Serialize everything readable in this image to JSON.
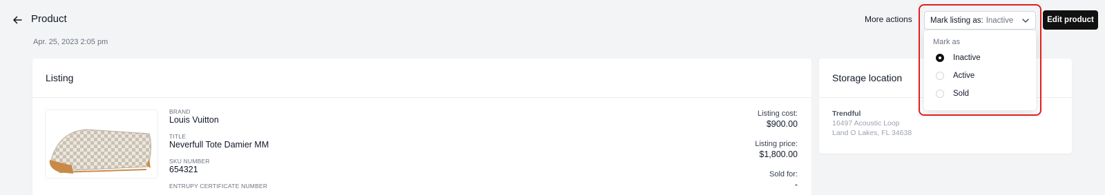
{
  "header": {
    "title": "Product",
    "timestamp": "Apr. 25, 2023 2:05 pm",
    "more_actions_label": "More actions",
    "mark_select": {
      "label": "Mark listing as:",
      "value": "Inactive"
    },
    "edit_label": "Edit product"
  },
  "dropdown": {
    "heading": "Mark as",
    "options": [
      {
        "label": "Inactive",
        "selected": true
      },
      {
        "label": "Active",
        "selected": false
      },
      {
        "label": "Sold",
        "selected": false
      }
    ]
  },
  "listing": {
    "title": "Listing",
    "fields": [
      {
        "label": "BRAND",
        "value": "Louis Vuitton"
      },
      {
        "label": "TITLE",
        "value": "Neverfull Tote Damier MM"
      },
      {
        "label": "SKU NUMBER",
        "value": "654321"
      },
      {
        "label": "ENTRUPY CERTIFICATE NUMBER",
        "value": ""
      }
    ],
    "prices": [
      {
        "label": "Listing cost:",
        "value": "$900.00"
      },
      {
        "label": "Listing price:",
        "value": "$1,800.00"
      },
      {
        "label": "Sold for:",
        "value": "-"
      }
    ]
  },
  "storage": {
    "title": "Storage location",
    "name": "Trendful",
    "address_line1": "16497 Acoustic Loop",
    "address_line2": "Land O Lakes, FL 34638"
  },
  "colors": {
    "background": "#f3f4f6",
    "primary_button": "#111111",
    "highlight": "#e11d1d"
  },
  "icons": {
    "back": "arrow-left-icon",
    "chevron": "chevron-down-icon"
  }
}
